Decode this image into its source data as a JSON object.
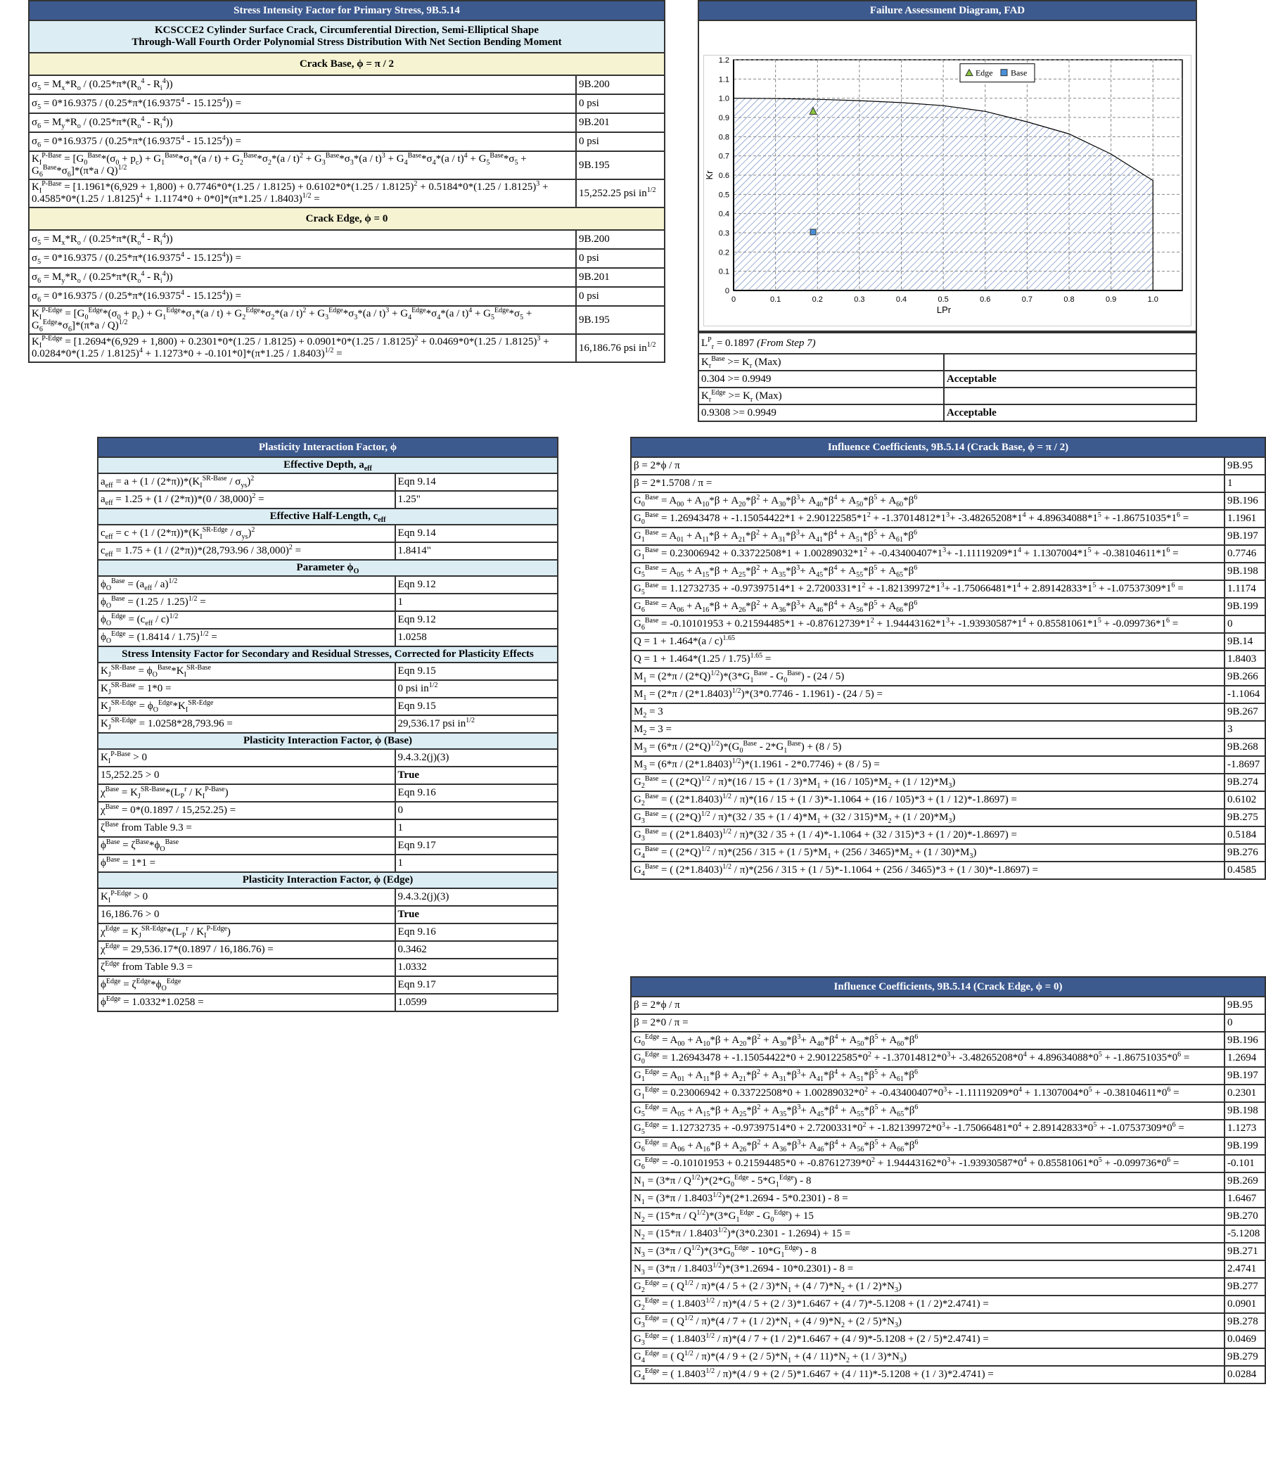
{
  "primary": {
    "title": "Stress Intensity Factor for Primary Stress, 9B.5.14",
    "subtitle_line1": "KCSCCE2 Cylinder Surface Crack, Circumferential Direction, Semi-Elliptical Shape",
    "subtitle_line2": "Through-Wall Fourth Order Polynomial Stress Distribution With Net Section Bending Moment",
    "sections": [
      {
        "heading": "Crack Base, ϕ = π / 2",
        "rows": [
          {
            "f": "σ_{5} = M_{x}*R_{o} / (0.25*π*(R_{o}^{4} - R_{i}^{4}))",
            "v": "9B.200"
          },
          {
            "f": "σ_{5} = 0*16.9375 / (0.25*π*(16.9375^{4} - 15.125^{4})) =",
            "v": "0 psi"
          },
          {
            "f": "σ_{6} = M_{y}*R_{o} / (0.25*π*(R_{o}^{4} - R_{i}^{4}))",
            "v": "9B.201"
          },
          {
            "f": "σ_{6} = 0*16.9375 / (0.25*π*(16.9375^{4} - 15.125^{4})) =",
            "v": "0 psi"
          },
          {
            "f": "K_{I}^{P-Base} = [G_{0}^{Base}*(σ_{0} + p_{c}) + G_{1}^{Base}*σ_{1}*(a / t) + G_{2}^{Base}*σ_{2}*(a / t)^{2} + G_{3}^{Base}*σ_{3}*(a / t)^{3} + G_{4}^{Base}*σ_{4}*(a / t)^{4} + G_{5}^{Base}*σ_{5} + G_{6}^{Base}*σ_{6}]*(π*a / Q)^{1/2}",
            "v": "9B.195"
          },
          {
            "f": "K_{I}^{P-Base} = [1.1961*(6,929 + 1,800) + 0.7746*0*(1.25 / 1.8125) + 0.6102*0*(1.25 / 1.8125)^{2} + 0.5184*0*(1.25 / 1.8125)^{3} + 0.4585*0*(1.25 / 1.8125)^{4} + 1.1174*0 + 0*0]*(π*1.25 / 1.8403)^{1/2} =",
            "v": "15,252.25 psi in^{1/2}"
          }
        ]
      },
      {
        "heading": "Crack Edge, ϕ = 0",
        "rows": [
          {
            "f": "σ_{5} = M_{x}*R_{o} / (0.25*π*(R_{o}^{4} - R_{i}^{4}))",
            "v": "9B.200"
          },
          {
            "f": "σ_{5} = 0*16.9375 / (0.25*π*(16.9375^{4} - 15.125^{4})) =",
            "v": "0 psi"
          },
          {
            "f": "σ_{6} = M_{y}*R_{o} / (0.25*π*(R_{o}^{4} - R_{i}^{4}))",
            "v": "9B.201"
          },
          {
            "f": "σ_{6} = 0*16.9375 / (0.25*π*(16.9375^{4} - 15.125^{4})) =",
            "v": "0 psi"
          },
          {
            "f": "K_{I}^{P-Edge} = [G_{0}^{Edge}*(σ_{0} + p_{c}) + G_{1}^{Edge}*σ_{1}*(a / t) + G_{2}^{Edge}*σ_{2}*(a / t)^{2} + G_{3}^{Edge}*σ_{3}*(a / t)^{3} + G_{4}^{Edge}*σ_{4}*(a / t)^{4} + G_{5}^{Edge}*σ_{5} + G_{6}^{Edge}*σ_{6}]*(π*a / Q)^{1/2}",
            "v": "9B.195"
          },
          {
            "f": "K_{I}^{P-Edge} = [1.2694*(6,929 + 1,800) + 0.2301*0*(1.25 / 1.8125) + 0.0901*0*(1.25 / 1.8125)^{2} + 0.0469*0*(1.25 / 1.8125)^{3} + 0.0284*0*(1.25 / 1.8125)^{4} + 1.1273*0 + -0.101*0]*(π*1.25 / 1.8403)^{1/2} =",
            "v": "16,186.76 psi in^{1/2}"
          }
        ]
      }
    ]
  },
  "fad": {
    "title": "Failure Assessment Diagram, FAD",
    "lpr_line": "L^{P}_{r} = 0.1897",
    "lpr_note": "(From Step 7)",
    "checks": [
      {
        "f": "K_{r}^{Base} >= K_{r} (Max)",
        "v": ""
      },
      {
        "f": "0.304 >= 0.9949",
        "v": "Acceptable"
      },
      {
        "f": "K_{r}^{Edge} >= K_{r} (Max)",
        "v": ""
      },
      {
        "f": "0.9308 >= 0.9949",
        "v": "Acceptable"
      }
    ]
  },
  "chart_data": {
    "type": "scatter",
    "title": "",
    "xlabel": "LPr",
    "ylabel": "Kr",
    "xlim": [
      0,
      1.07
    ],
    "ylim": [
      0,
      1.2
    ],
    "xticks": [
      "0",
      "0.1",
      "0.2",
      "0.3",
      "0.4",
      "0.5",
      "0.6",
      "0.7",
      "0.8",
      "0.9",
      "1.0"
    ],
    "yticks": [
      "0",
      "0.1",
      "0.2",
      "0.3",
      "0.4",
      "0.5",
      "0.6",
      "0.7",
      "0.8",
      "0.9",
      "1.0",
      "1.1",
      "1.2"
    ],
    "grid": true,
    "legend_position": "top-center",
    "envelope": {
      "name": "FAD",
      "x": [
        0,
        0.1,
        0.2,
        0.3,
        0.4,
        0.5,
        0.6,
        0.7,
        0.8,
        0.9,
        1.0
      ],
      "y": [
        1.0,
        0.9986,
        0.9944,
        0.9874,
        0.9773,
        0.9615,
        0.9317,
        0.8771,
        0.8145,
        0.7097,
        0.572
      ],
      "lr_max": 1.0,
      "fill": "hatched"
    },
    "series": [
      {
        "name": "Edge",
        "marker": "triangle",
        "color": "#8cc63f",
        "x": [
          0.1897
        ],
        "y": [
          0.9308
        ]
      },
      {
        "name": "Base",
        "marker": "square",
        "color": "#4a90d9",
        "x": [
          0.1897
        ],
        "y": [
          0.304
        ]
      }
    ]
  },
  "plasticity": {
    "title": "Plasticity Interaction Factor, ϕ",
    "sections": [
      {
        "heading": "Effective Depth, a_{eff}",
        "rows": [
          {
            "f": "a_{eff} = a + (1 / (2*π))*(K_{I}^{SR-Base} / σ_{ys})^{2}",
            "v": "Eqn 9.14"
          },
          {
            "f": "a_{eff} = 1.25 + (1 / (2*π))*(0 / 38,000)^{2} =",
            "v": "1.25\""
          }
        ]
      },
      {
        "heading": "Effective Half-Length, c_{eff}",
        "rows": [
          {
            "f": "c_{eff} = c + (1 / (2*π))*(K_{I}^{SR-Edge} / σ_{ys})^{2}",
            "v": "Eqn 9.14"
          },
          {
            "f": "c_{eff} = 1.75 + (1 / (2*π))*(28,793.96 / 38,000)^{2} =",
            "v": "1.8414\""
          }
        ]
      },
      {
        "heading": "Parameter ϕ_{O}",
        "rows": [
          {
            "f": "ϕ_{O}^{Base} = (a_{eff} / a)^{1/2}",
            "v": "Eqn 9.12"
          },
          {
            "f": "ϕ_{O}^{Base} = (1.25 / 1.25)^{1/2} =",
            "v": "1"
          },
          {
            "f": "ϕ_{O}^{Edge} = (c_{eff} / c)^{1/2}",
            "v": "Eqn 9.12"
          },
          {
            "f": "ϕ_{O}^{Edge} = (1.8414 / 1.75)^{1/2} =",
            "v": "1.0258"
          }
        ]
      },
      {
        "heading": "Stress Intensity Factor for Secondary and Residual Stresses, Corrected for Plasticity Effects",
        "rows": [
          {
            "f": "K_{J}^{SR-Base} = ϕ_{O}^{Base}*K_{I}^{SR-Base}",
            "v": "Eqn 9.15"
          },
          {
            "f": "K_{J}^{SR-Base} = 1*0 =",
            "v": "0 psi in^{1/2}"
          },
          {
            "f": "K_{J}^{SR-Edge} = ϕ_{O}^{Edge}*K_{I}^{SR-Edge}",
            "v": "Eqn 9.15"
          },
          {
            "f": "K_{J}^{SR-Edge} = 1.0258*28,793.96 =",
            "v": "29,536.17 psi in^{1/2}"
          }
        ]
      },
      {
        "heading": "Plasticity Interaction Factor, ϕ (Base)",
        "rows": [
          {
            "f": "K_{I}^{P-Base} > 0",
            "v": "9.4.3.2(j)(3)"
          },
          {
            "f": "15,252.25 > 0",
            "v": "True",
            "bold": true
          },
          {
            "f": "χ^{Base} = K_{J}^{SR-Base}*(L_{P}^{r} / K_{I}^{P-Base})",
            "v": "Eqn 9.16"
          },
          {
            "f": "χ^{Base} = 0*(0.1897 / 15,252.25) =",
            "v": "0"
          },
          {
            "f": "ζ^{Base} from Table 9.3 =",
            "v": "1"
          },
          {
            "f": "ϕ^{Base} = ζ^{Base}*ϕ_{O}^{Base}",
            "v": "Eqn 9.17"
          },
          {
            "f": "ϕ^{Base} = 1*1 =",
            "v": "1"
          }
        ]
      },
      {
        "heading": "Plasticity Interaction Factor, ϕ (Edge)",
        "rows": [
          {
            "f": "K_{I}^{P-Edge} > 0",
            "v": "9.4.3.2(j)(3)"
          },
          {
            "f": "16,186.76 > 0",
            "v": "True",
            "bold": true
          },
          {
            "f": "χ^{Edge} = K_{J}^{SR-Edge}*(L_{P}^{r} / K_{I}^{P-Edge})",
            "v": "Eqn 9.16"
          },
          {
            "f": "χ^{Edge} = 29,536.17*(0.1897 / 16,186.76) =",
            "v": "0.3462"
          },
          {
            "f": "ζ^{Edge} from Table 9.3 =",
            "v": "1.0332"
          },
          {
            "f": "ϕ^{Edge} = ζ^{Edge}*ϕ_{O}^{Edge}",
            "v": "Eqn 9.17"
          },
          {
            "f": "ϕ^{Edge} = 1.0332*1.0258 =",
            "v": "1.0599"
          }
        ]
      }
    ]
  },
  "influence_base": {
    "title": "Influence Coefficients, 9B.5.14 (Crack Base, ϕ = π / 2)",
    "rows": [
      {
        "f": "β = 2*ϕ / π",
        "v": "9B.95"
      },
      {
        "f": "β = 2*1.5708 / π =",
        "v": "1"
      },
      {
        "f": "G_{0}^{Base} = A_{00} + A_{10}*β + A_{20}*β^{2} + A_{30}*β^{3}+ A_{40}*β^{4} + A_{50}*β^{5} + A_{60}*β^{6}",
        "v": "9B.196"
      },
      {
        "f": "G_{0}^{Base} = 1.26943478 + -1.15054422*1 + 2.90122585*1^{2} + -1.37014812*1^{3}+ -3.48265208*1^{4} + 4.89634088*1^{5} + -1.86751035*1^{6} =",
        "v": "1.1961"
      },
      {
        "f": "G_{1}^{Base} = A_{01} + A_{11}*β + A_{21}*β^{2} + A_{31}*β^{3}+ A_{41}*β^{4} + A_{51}*β^{5} + A_{61}*β^{6}",
        "v": "9B.197"
      },
      {
        "f": "G_{1}^{Base} = 0.23006942 + 0.33722508*1 + 1.00289032*1^{2} + -0.43400407*1^{3}+ -1.11119209*1^{4} + 1.1307004*1^{5} + -0.38104611*1^{6} =",
        "v": "0.7746"
      },
      {
        "f": "G_{5}^{Base} = A_{05} + A_{15}*β + A_{25}*β^{2} + A_{35}*β^{3}+ A_{45}*β^{4} + A_{55}*β^{5} + A_{65}*β^{6}",
        "v": "9B.198"
      },
      {
        "f": "G_{5}^{Base} = 1.12732735 + -0.97397514*1 + 2.7200331*1^{2} + -1.82139972*1^{3}+ -1.75066481*1^{4} + 2.89142833*1^{5} + -1.07537309*1^{6} =",
        "v": "1.1174"
      },
      {
        "f": "G_{6}^{Base} = A_{06} + A_{16}*β + A_{26}*β^{2} + A_{36}*β^{3}+ A_{46}*β^{4} + A_{56}*β^{5} + A_{66}*β^{6}",
        "v": "9B.199"
      },
      {
        "f": "G_{6}^{Base} = -0.10101953 + 0.21594485*1 + -0.87612739*1^{2} + 1.94443162*1^{3}+ -1.93930587*1^{4} + 0.85581061*1^{5} + -0.099736*1^{6} =",
        "v": "0"
      },
      {
        "f": "Q = 1 + 1.464*(a / c)^{1.65}",
        "v": "9B.14"
      },
      {
        "f": "Q = 1 + 1.464*(1.25 / 1.75)^{1.65} =",
        "v": "1.8403"
      },
      {
        "f": "M_{1} = (2*π / (2*Q)^{1/2})*(3*G_{1}^{Base} - G_{0}^{Base}) - (24 / 5)",
        "v": "9B.266"
      },
      {
        "f": "M_{1} = (2*π / (2*1.8403)^{1/2})*(3*0.7746 - 1.1961) - (24 / 5) =",
        "v": "-1.1064"
      },
      {
        "f": "M_{2} = 3",
        "v": "9B.267"
      },
      {
        "f": "M_{2} = 3 =",
        "v": "3"
      },
      {
        "f": "M_{3} = (6*π / (2*Q)^{1/2})*(G_{0}^{Base} - 2*G_{1}^{Base}) + (8 / 5)",
        "v": "9B.268"
      },
      {
        "f": "M_{3} = (6*π / (2*1.8403)^{1/2})*(1.1961 - 2*0.7746) + (8 / 5) =",
        "v": "-1.8697"
      },
      {
        "f": "G_{2}^{Base} = ( (2*Q)^{1/2} / π)*(16 / 15 + (1 / 3)*M_{1} + (16 / 105)*M_{2} + (1 / 12)*M_{3})",
        "v": "9B.274"
      },
      {
        "f": "G_{2}^{Base} = ( (2*1.8403)^{1/2} / π)*(16 / 15 + (1 / 3)*-1.1064 + (16 / 105)*3 + (1 / 12)*-1.8697) =",
        "v": "0.6102"
      },
      {
        "f": "G_{3}^{Base} = ( (2*Q)^{1/2} / π)*(32 / 35 + (1 / 4)*M_{1} + (32 / 315)*M_{2} + (1 / 20)*M_{3})",
        "v": "9B.275"
      },
      {
        "f": "G_{3}^{Base} = ( (2*1.8403)^{1/2} / π)*(32 / 35 + (1 / 4)*-1.1064 + (32 / 315)*3 + (1 / 20)*-1.8697) =",
        "v": "0.5184"
      },
      {
        "f": "G_{4}^{Base} = ( (2*Q)^{1/2} / π)*(256 / 315 + (1 / 5)*M_{1} + (256 / 3465)*M_{2} + (1 / 30)*M_{3})",
        "v": "9B.276"
      },
      {
        "f": "G_{4}^{Base} = ( (2*1.8403)^{1/2} / π)*(256 / 315 + (1 / 5)*-1.1064 + (256 / 3465)*3 + (1 / 30)*-1.8697) =",
        "v": "0.4585"
      }
    ]
  },
  "influence_edge": {
    "title": "Influence Coefficients, 9B.5.14 (Crack Edge, ϕ = 0)",
    "rows": [
      {
        "f": "β = 2*ϕ / π",
        "v": "9B.95"
      },
      {
        "f": "β = 2*0 / π =",
        "v": "0"
      },
      {
        "f": "G_{0}^{Edge} = A_{00} + A_{10}*β + A_{20}*β^{2} + A_{30}*β^{3}+ A_{40}*β^{4} + A_{50}*β^{5} + A_{60}*β^{6}",
        "v": "9B.196"
      },
      {
        "f": "G_{0}^{Edge} = 1.26943478 + -1.15054422*0 + 2.90122585*0^{2} + -1.37014812*0^{3}+ -3.48265208*0^{4} + 4.89634088*0^{5} + -1.86751035*0^{6} =",
        "v": "1.2694"
      },
      {
        "f": "G_{1}^{Edge} = A_{01} + A_{11}*β + A_{21}*β^{2} + A_{31}*β^{3}+ A_{41}*β^{4} + A_{51}*β^{5} + A_{61}*β^{6}",
        "v": "9B.197"
      },
      {
        "f": "G_{1}^{Edge} = 0.23006942 + 0.33722508*0 + 1.00289032*0^{2} + -0.43400407*0^{3}+ -1.11119209*0^{4} + 1.1307004*0^{5} + -0.38104611*0^{6} =",
        "v": "0.2301"
      },
      {
        "f": "G_{5}^{Edge} = A_{05} + A_{15}*β + A_{25}*β^{2} + A_{35}*β^{3}+ A_{45}*β^{4} + A_{55}*β^{5} + A_{65}*β^{6}",
        "v": "9B.198"
      },
      {
        "f": "G_{5}^{Edge} = 1.12732735 + -0.97397514*0 + 2.7200331*0^{2} + -1.82139972*0^{3}+ -1.75066481*0^{4} + 2.89142833*0^{5} + -1.07537309*0^{6} =",
        "v": "1.1273"
      },
      {
        "f": "G_{6}^{Edge} = A_{06} + A_{16}*β + A_{26}*β^{2} + A_{36}*β^{3}+ A_{46}*β^{4} + A_{56}*β^{5} + A_{66}*β^{6}",
        "v": "9B.199"
      },
      {
        "f": "G_{6}^{Edge} = -0.10101953 + 0.21594485*0 + -0.87612739*0^{2} + 1.94443162*0^{3}+ -1.93930587*0^{4} + 0.85581061*0^{5} + -0.099736*0^{6} =",
        "v": "-0.101"
      },
      {
        "f": "N_{1} = (3*π / Q^{1/2})*(2*G_{0}^{Edge} - 5*G_{1}^{Edge}) - 8",
        "v": "9B.269"
      },
      {
        "f": "N_{1} = (3*π / 1.8403^{1/2})*(2*1.2694 - 5*0.2301) - 8 =",
        "v": "1.6467"
      },
      {
        "f": "N_{2} = (15*π / Q^{1/2})*(3*G_{1}^{Edge} - G_{0}^{Edge}) + 15",
        "v": "9B.270"
      },
      {
        "f": "N_{2} = (15*π / 1.8403^{1/2})*(3*0.2301 - 1.2694) + 15 =",
        "v": "-5.1208"
      },
      {
        "f": "N_{3} = (3*π / Q^{1/2})*(3*G_{0}^{Edge} - 10*G_{1}^{Edge}) - 8",
        "v": "9B.271"
      },
      {
        "f": "N_{3} = (3*π / 1.8403^{1/2})*(3*1.2694 - 10*0.2301) - 8 =",
        "v": "2.4741"
      },
      {
        "f": "G_{2}^{Edge} = ( Q^{1/2} / π)*(4 / 5 + (2 / 3)*N_{1} + (4 / 7)*N_{2} + (1 / 2)*N_{3})",
        "v": "9B.277"
      },
      {
        "f": "G_{2}^{Edge} = ( 1.8403^{1/2} / π)*(4 / 5 + (2 / 3)*1.6467 + (4 / 7)*-5.1208 + (1 / 2)*2.4741) =",
        "v": "0.0901"
      },
      {
        "f": "G_{3}^{Edge} = ( Q^{1/2} / π)*(4 / 7 + (1 / 2)*N_{1} + (4 / 9)*N_{2} + (2 / 5)*N_{3})",
        "v": "9B.278"
      },
      {
        "f": "G_{3}^{Edge} = ( 1.8403^{1/2} / π)*(4 / 7 + (1 / 2)*1.6467 + (4 / 9)*-5.1208 + (2 / 5)*2.4741) =",
        "v": "0.0469"
      },
      {
        "f": "G_{4}^{Edge} = ( Q^{1/2} / π)*(4 / 9 + (2 / 5)*N_{1} + (4 / 11)*N_{2} + (1 / 3)*N_{3})",
        "v": "9B.279"
      },
      {
        "f": "G_{4}^{Edge} = ( 1.8403^{1/2} / π)*(4 / 9 + (2 / 5)*1.6467 + (4 / 11)*-5.1208 + (1 / 3)*2.4741) =",
        "v": "0.0284"
      }
    ]
  }
}
